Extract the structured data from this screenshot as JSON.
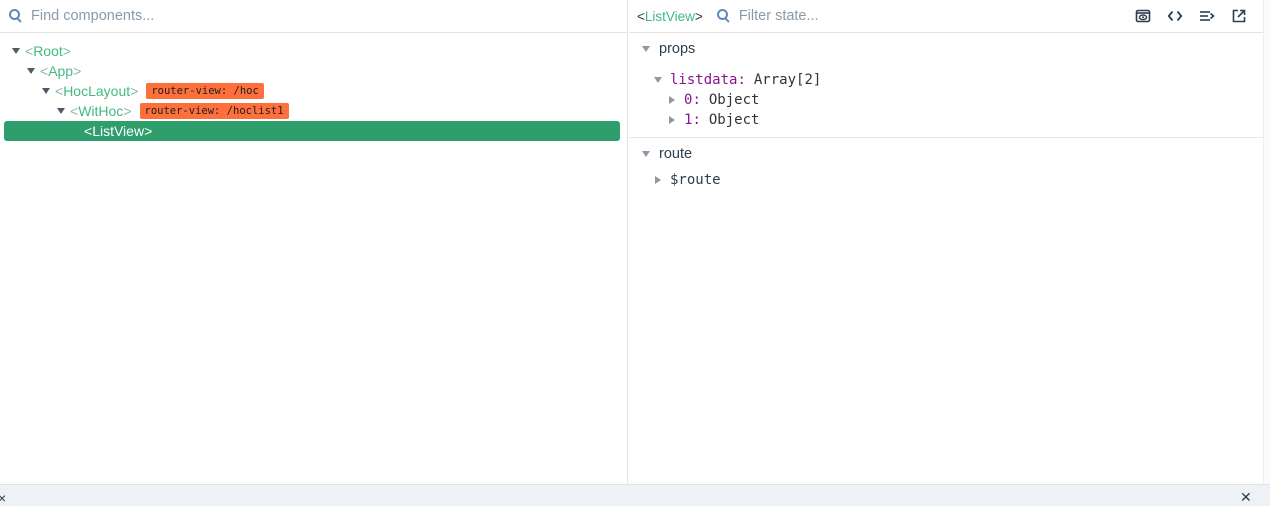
{
  "left": {
    "search_placeholder": "Find components..."
  },
  "tree": [
    {
      "name": "Root",
      "badge": ""
    },
    {
      "name": "App",
      "badge": ""
    },
    {
      "name": "HocLayout",
      "badge": "router-view: /hoc"
    },
    {
      "name": "WitHoc",
      "badge": "router-view: /hoclist1"
    },
    {
      "name": "ListView",
      "badge": ""
    }
  ],
  "right": {
    "inspected": "ListView",
    "filter_placeholder": "Filter state...",
    "tools": [
      "inspect-dom-icon",
      "open-source-icon",
      "scroll-to-component-icon",
      "open-in-new-window-icon"
    ]
  },
  "state": {
    "props_title": "props",
    "listdata_key": "listdata",
    "listdata_value": "Array[2]",
    "item0_key": "0",
    "item0_value": "Object",
    "item1_key": "1",
    "item1_value": "Object",
    "route_title": "route",
    "route_key": "$route"
  },
  "bottom": {
    "left_close": "×",
    "right_close": "✕"
  },
  "colors": {
    "accent": "#42b983",
    "selected_bg": "#2e9e6c",
    "badge_bg": "#ff6f3c",
    "key": "#881391"
  }
}
